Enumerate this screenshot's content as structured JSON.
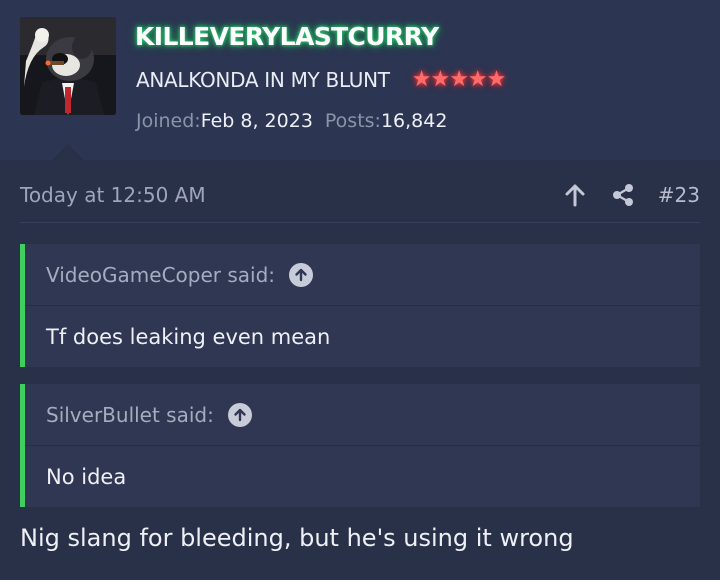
{
  "user": {
    "username": "KILLEVERYLASTCURRY",
    "title": "ANALKONDA IN MY BLUNT",
    "stars": [
      "★",
      "★",
      "★",
      "★",
      "★"
    ],
    "joined_label": "Joined:",
    "joined_value": "Feb 8, 2023",
    "posts_label": "Posts:",
    "posts_value": "16,842",
    "username_glow_color": "#2ecc71",
    "star_color": "#ff6b6b"
  },
  "post": {
    "date": "Today at 12:50 AM",
    "number": "#23",
    "actions": [
      "arrow-up-icon",
      "share-icon"
    ]
  },
  "quotes": [
    {
      "author_label": "VideoGameCoper said:",
      "text": "Tf does leaking even mean"
    },
    {
      "author_label": "SilverBullet said:",
      "text": "No idea"
    }
  ],
  "reply_text": "Nig slang for bleeding, but he's using it wrong",
  "colors": {
    "background": "#293149",
    "header_background": "#2c3552",
    "quote_border": "#3fcf5e"
  }
}
